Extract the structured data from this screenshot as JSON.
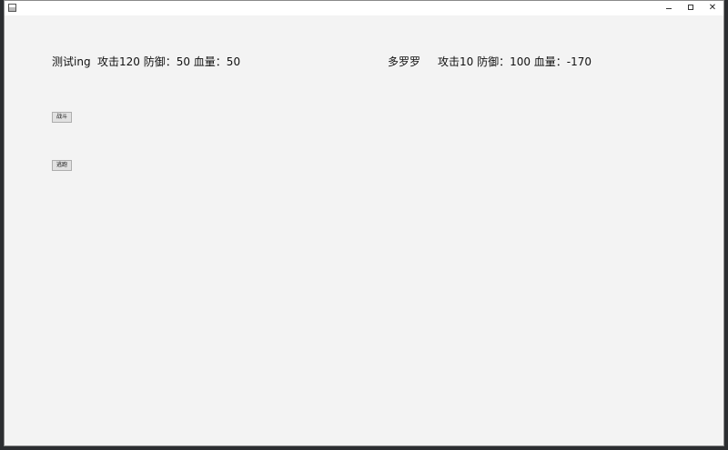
{
  "window": {
    "title": "",
    "controls": {
      "minimize": "–",
      "maximize": "",
      "close": "✕"
    }
  },
  "player": {
    "name": "测试ing",
    "stats": "攻击120 防御：50 血量：50"
  },
  "enemy": {
    "name": "多罗罗",
    "stats": "攻击10 防御：100 血量：-170"
  },
  "buttons": {
    "fight": "战斗",
    "flee": "逃跑"
  },
  "icons": {
    "app": "app-window-icon",
    "minimize": "minimize-icon",
    "maximize": "maximize-icon",
    "close": "close-icon"
  }
}
